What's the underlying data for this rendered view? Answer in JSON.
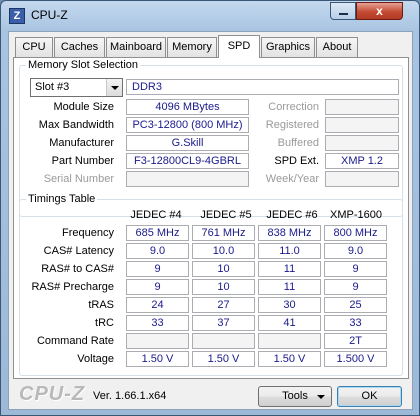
{
  "window": {
    "title": "CPU-Z",
    "close_glyph": "x"
  },
  "tabs": [
    "CPU",
    "Caches",
    "Mainboard",
    "Memory",
    "SPD",
    "Graphics",
    "About"
  ],
  "active_tab": "SPD",
  "slot_selection": {
    "legend": "Memory Slot Selection",
    "slot": "Slot #3",
    "memory_type": "DDR3",
    "labels": {
      "module_size": "Module Size",
      "max_bandwidth": "Max Bandwidth",
      "manufacturer": "Manufacturer",
      "part_number": "Part Number",
      "serial_number": "Serial Number",
      "correction": "Correction",
      "registered": "Registered",
      "buffered": "Buffered",
      "spd_ext": "SPD Ext.",
      "week_year": "Week/Year"
    },
    "values": {
      "module_size": "4096 MBytes",
      "max_bandwidth": "PC3-12800 (800 MHz)",
      "manufacturer": "G.Skill",
      "part_number": "F3-12800CL9-4GBRL",
      "serial_number": "",
      "correction": "",
      "registered": "",
      "buffered": "",
      "spd_ext": "XMP 1.2",
      "week_year": ""
    }
  },
  "timings": {
    "legend": "Timings Table",
    "columns": [
      "JEDEC #4",
      "JEDEC #5",
      "JEDEC #6",
      "XMP-1600"
    ],
    "rows": [
      {
        "label": "Frequency",
        "values": [
          "685 MHz",
          "761 MHz",
          "838 MHz",
          "800 MHz"
        ]
      },
      {
        "label": "CAS# Latency",
        "values": [
          "9.0",
          "10.0",
          "11.0",
          "9.0"
        ]
      },
      {
        "label": "RAS# to CAS#",
        "values": [
          "9",
          "10",
          "11",
          "9"
        ]
      },
      {
        "label": "RAS# Precharge",
        "values": [
          "9",
          "10",
          "11",
          "9"
        ]
      },
      {
        "label": "tRAS",
        "values": [
          "24",
          "27",
          "30",
          "25"
        ]
      },
      {
        "label": "tRC",
        "values": [
          "33",
          "37",
          "41",
          "33"
        ]
      },
      {
        "label": "Command Rate",
        "values": [
          "",
          "",
          "",
          "2T"
        ]
      },
      {
        "label": "Voltage",
        "values": [
          "1.50 V",
          "1.50 V",
          "1.50 V",
          "1.500 V"
        ]
      }
    ]
  },
  "footer": {
    "logo": "CPU-Z",
    "version": "Ver. 1.66.1.x64",
    "tools_label": "Tools",
    "ok_label": "OK"
  }
}
